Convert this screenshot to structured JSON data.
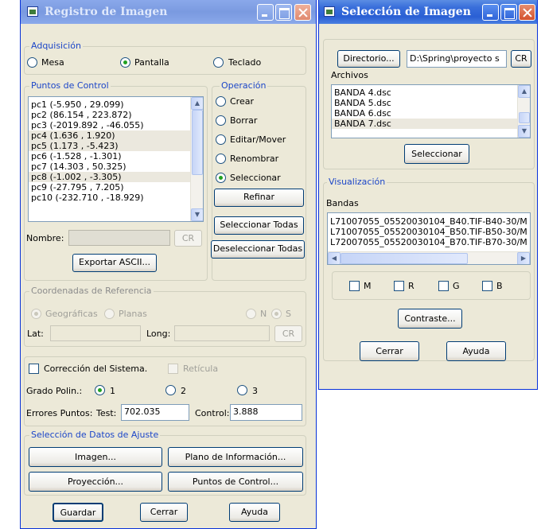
{
  "registro": {
    "title": "Registro de Imagen",
    "adquisicion": {
      "legend": "Adquisición",
      "options": [
        {
          "label": "Mesa",
          "selected": false
        },
        {
          "label": "Pantalla",
          "selected": true
        },
        {
          "label": "Teclado",
          "selected": false
        }
      ]
    },
    "puntos": {
      "legend": "Puntos de Control",
      "items": [
        "pc1 (-5.950 , 29.099)",
        "pc2 (86.154 , 223.872)",
        "pc3 (-2019.892 , -46.055)",
        "pc4 (1.636 , 1.920)",
        "pc5 (1.173 , -5.423)",
        "pc6 (-1.528 , -1.301)",
        "pc7 (14.303 , 50.325)",
        "pc8 (-1.002 , -3.305)",
        "pc9 (-27.795 , 7.205)",
        "pc10 (-232.710 , -18.929)"
      ],
      "nombre_label": "Nombre:",
      "nombre_value": "",
      "cr_label": "CR",
      "exportar_label": "Exportar ASCII..."
    },
    "operacion": {
      "legend": "Operación",
      "options": [
        {
          "label": "Crear",
          "selected": false
        },
        {
          "label": "Borrar",
          "selected": false
        },
        {
          "label": "Editar/Mover",
          "selected": false
        },
        {
          "label": "Renombrar",
          "selected": false
        },
        {
          "label": "Seleccionar",
          "selected": true
        }
      ],
      "refinar_label": "Refinar",
      "seleccionar_todas_label": "Seleccionar Todas",
      "deseleccionar_todas_label": "Deseleccionar Todas"
    },
    "coordenadas": {
      "legend": "Coordenadas de Referencia",
      "geograficas_label": "Geográficas",
      "planas_label": "Planas",
      "n_label": "N",
      "s_label": "S",
      "lat_label": "Lat:",
      "long_label": "Long:",
      "cr_label": "CR"
    },
    "correccion": {
      "correccion_label": "Corrección del Sistema.",
      "reticula_label": "Retícula",
      "grado_label": "Grado Polin.:",
      "grado_options": [
        {
          "label": "1",
          "selected": true
        },
        {
          "label": "2",
          "selected": false
        },
        {
          "label": "3",
          "selected": false
        }
      ],
      "errores_label": "Errores Puntos:",
      "test_label": "Test:",
      "test_value": "702.035",
      "control_label": "Control:",
      "control_value": "3.888"
    },
    "seleccion_datos": {
      "legend": "Selección de Datos de Ajuste",
      "imagen_label": "Imagen...",
      "plano_label": "Plano de Información...",
      "proyeccion_label": "Proyección...",
      "puntos_control_label": "Puntos de Control..."
    },
    "footer": {
      "guardar_label": "Guardar",
      "cerrar_label": "Cerrar",
      "ayuda_label": "Ayuda"
    }
  },
  "seleccion": {
    "title": "Selección de Imagen",
    "directorio_label": "Directorio...",
    "directorio_value": "D:\\Spring\\proyecto s",
    "cr_label": "CR",
    "archivos_label": "Archivos",
    "archivos": [
      "BANDA 4.dsc",
      "BANDA 5.dsc",
      "BANDA 6.dsc",
      "BANDA 7.dsc"
    ],
    "seleccionar_label": "Seleccionar",
    "visualizacion_legend": "Visualización",
    "bandas_label": "Bandas",
    "bandas": [
      "L71007055_05520030104_B40.TIF-B40-30/M",
      "L71007055_05520030104_B50.TIF-B50-30/M",
      "L72007055_05520030104_B70.TIF-B70-30/M"
    ],
    "checks": [
      "M",
      "R",
      "G",
      "B"
    ],
    "contraste_label": "Contraste...",
    "cerrar_label": "Cerrar",
    "ayuda_label": "Ayuda"
  },
  "colors": {
    "title_active": "#2a5fd4",
    "title_inactive": "#7a9ae0",
    "group_legend": "#1c46c8",
    "window_bg": "#ece9d8",
    "radio_dot": "#21a121"
  }
}
